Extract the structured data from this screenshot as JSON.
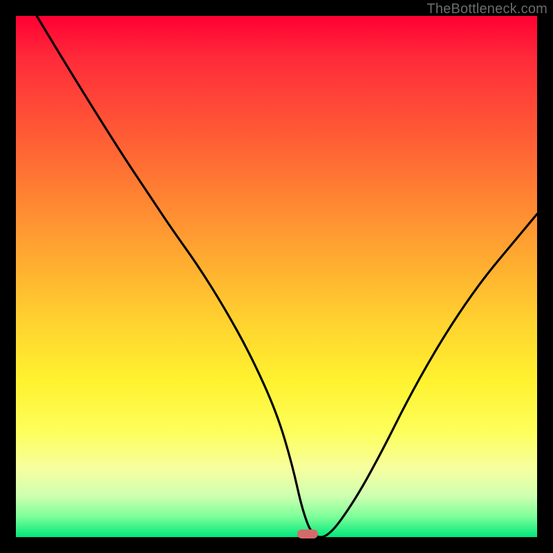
{
  "watermark": "TheBottleneck.com",
  "colors": {
    "background": "#000000",
    "curve": "#000000",
    "pill": "#d56a6a",
    "watermark": "#6c6c6c"
  },
  "chart_data": {
    "type": "line",
    "title": "",
    "xlabel": "",
    "ylabel": "",
    "xlim": [
      0,
      100
    ],
    "ylim": [
      0,
      100
    ],
    "grid": false,
    "legend": false,
    "annotations": [
      {
        "kind": "pill-marker",
        "x": 56,
        "y": 0
      }
    ],
    "series": [
      {
        "name": "bottleneck-curve",
        "x": [
          4,
          10,
          20,
          26,
          30,
          35,
          40,
          45,
          50,
          53,
          55,
          57,
          60,
          65,
          70,
          75,
          80,
          85,
          90,
          95,
          100
        ],
        "values": [
          100,
          90,
          74,
          65,
          59,
          52,
          44,
          35,
          24,
          14,
          5,
          0,
          0,
          7,
          16,
          26,
          35,
          43,
          50,
          56,
          62
        ]
      }
    ],
    "background_gradient": {
      "direction": "vertical",
      "stops": [
        {
          "position": 0,
          "color": "#ff0033"
        },
        {
          "position": 8,
          "color": "#ff2a3a"
        },
        {
          "position": 20,
          "color": "#ff5236"
        },
        {
          "position": 32,
          "color": "#ff7a33"
        },
        {
          "position": 45,
          "color": "#ffa531"
        },
        {
          "position": 58,
          "color": "#ffd02f"
        },
        {
          "position": 70,
          "color": "#fff22f"
        },
        {
          "position": 80,
          "color": "#fdff5d"
        },
        {
          "position": 87,
          "color": "#f6ffa0"
        },
        {
          "position": 92,
          "color": "#cfffb0"
        },
        {
          "position": 96,
          "color": "#7fff9a"
        },
        {
          "position": 100,
          "color": "#00e77c"
        }
      ]
    }
  }
}
